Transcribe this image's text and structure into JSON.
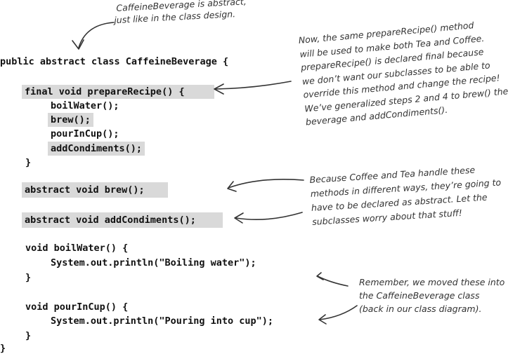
{
  "code": {
    "class_decl": "public abstract class CaffeineBeverage {",
    "prepare_recipe_decl": "final void prepareRecipe() {",
    "boil_water_call": "boilWater();",
    "brew_call": "brew();",
    "pour_in_cup_call": "pourInCup();",
    "add_condiments_call": "addCondiments();",
    "close_method_1": "}",
    "abstract_brew": "abstract void brew();",
    "abstract_add_condiments": "abstract void addCondiments();",
    "boil_water_decl": "void boilWater() {",
    "boil_water_println": "System.out.println(\"Boiling water\");",
    "close_method_2": "}",
    "pour_in_cup_decl": "void pourInCup() {",
    "pour_in_cup_println": "System.out.println(\"Pouring into cup\");",
    "close_method_3": "}",
    "close_class": "}"
  },
  "annotations": {
    "abstract_note": [
      "CaffeineBeverage is abstract,",
      "just like in the class design."
    ],
    "prepare_recipe_note": [
      "Now, the same prepareRecipe() method",
      "will be used to make both Tea and Coffee.",
      "prepareRecipe() is declared final because",
      "we don’t want our subclasses to be able to",
      "override this method and change the recipe!",
      "We’ve generalized steps 2 and 4 to brew() the",
      "beverage and addCondiments()."
    ],
    "abstract_methods_note": [
      "Because Coffee and Tea handle these",
      "methods in different ways, they’re going to",
      "have to be declared as abstract. Let the",
      "subclasses worry about that stuff!"
    ],
    "moved_note": [
      "Remember, we moved these into",
      "the CaffeineBeverage class",
      "(back in our class diagram)."
    ]
  }
}
